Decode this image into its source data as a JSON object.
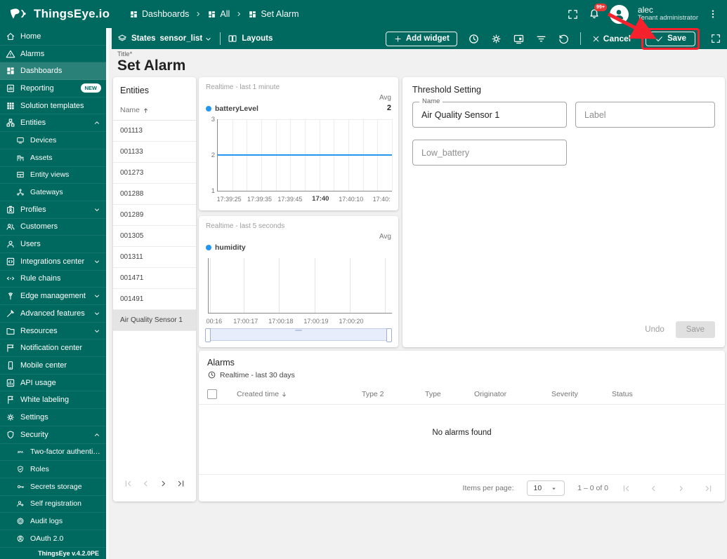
{
  "app": {
    "logo_text": "ThingsEye.io",
    "version": "ThingsEye v.4.2.0PE"
  },
  "colors": {
    "primary": "#00695f",
    "annotation_red": "#f5222d",
    "series_blue": "#2196f3"
  },
  "header": {
    "breadcrumbs": [
      {
        "label": "Dashboards",
        "icon": "dashboard"
      },
      {
        "label": "All",
        "icon": "dashboard"
      },
      {
        "label": "Set Alarm",
        "icon": "dashboard"
      }
    ],
    "notification_badge": "99+",
    "user": {
      "name": "alec",
      "role": "Tenant administrator"
    }
  },
  "toolbar": {
    "states_label": "States",
    "state_value": "sensor_list",
    "layouts_label": "Layouts",
    "add_widget_label": "Add widget",
    "cancel_label": "Cancel",
    "save_label": "Save"
  },
  "sidebar": {
    "items": [
      {
        "label": "Home",
        "icon": "home"
      },
      {
        "label": "Alarms",
        "icon": "warning"
      },
      {
        "label": "Dashboards",
        "icon": "dashboard",
        "active": true
      },
      {
        "label": "Reporting",
        "icon": "reporting",
        "badge": "NEW"
      },
      {
        "label": "Solution templates",
        "icon": "templates"
      },
      {
        "label": "Entities",
        "icon": "entities",
        "chevron": "up"
      },
      {
        "label": "Devices",
        "icon": "devices",
        "child": true
      },
      {
        "label": "Assets",
        "icon": "assets",
        "child": true
      },
      {
        "label": "Entity views",
        "icon": "entity-views",
        "child": true
      },
      {
        "label": "Gateways",
        "icon": "gateways",
        "child": true
      },
      {
        "label": "Profiles",
        "icon": "profiles",
        "chevron": "down"
      },
      {
        "label": "Customers",
        "icon": "customers"
      },
      {
        "label": "Users",
        "icon": "users"
      },
      {
        "label": "Integrations center",
        "icon": "integrations",
        "chevron": "down"
      },
      {
        "label": "Rule chains",
        "icon": "rule-chains"
      },
      {
        "label": "Edge management",
        "icon": "edge",
        "chevron": "down"
      },
      {
        "label": "Advanced features",
        "icon": "advanced",
        "chevron": "down"
      },
      {
        "label": "Resources",
        "icon": "resources",
        "chevron": "down"
      },
      {
        "label": "Notification center",
        "icon": "notification"
      },
      {
        "label": "Mobile center",
        "icon": "mobile"
      },
      {
        "label": "API usage",
        "icon": "api"
      },
      {
        "label": "White labeling",
        "icon": "white-label"
      },
      {
        "label": "Settings",
        "icon": "settings"
      },
      {
        "label": "Security",
        "icon": "security",
        "chevron": "up"
      },
      {
        "label": "Two-factor authenticati...",
        "icon": "2fa",
        "child": true
      },
      {
        "label": "Roles",
        "icon": "roles",
        "child": true
      },
      {
        "label": "Secrets storage",
        "icon": "secrets",
        "child": true
      },
      {
        "label": "Self registration",
        "icon": "self-reg",
        "child": true
      },
      {
        "label": "Audit logs",
        "icon": "audit",
        "child": true
      },
      {
        "label": "OAuth 2.0",
        "icon": "oauth",
        "child": true
      }
    ]
  },
  "page": {
    "title_label": "Title*",
    "title": "Set Alarm"
  },
  "entities_panel": {
    "title": "Entities",
    "column_label": "Name",
    "rows": [
      "001113",
      "001133",
      "001273",
      "001288",
      "001289",
      "001305",
      "001311",
      "001471",
      "001491",
      "Air Quality Sensor 1"
    ],
    "selected_index": 9
  },
  "chart_data": [
    {
      "type": "line",
      "title": "Realtime - last 1 minute",
      "agg_label": "Avg",
      "agg_value": "2",
      "series": [
        {
          "name": "batteryLevel",
          "color": "#2196f3",
          "constant_value": 2
        }
      ],
      "ylim": [
        1,
        3
      ],
      "yticks": [
        3,
        2,
        1
      ],
      "xticks": [
        "17:39:25",
        "17:39:35",
        "17:39:45",
        "17:40",
        "17:40:10",
        "17:40:"
      ],
      "bold_xtick_index": 3,
      "grid": true,
      "legend_position": "top-left"
    },
    {
      "type": "line",
      "title": "Realtime - last 5 seconds",
      "agg_label": "Avg",
      "agg_value": "",
      "series": [
        {
          "name": "humidity",
          "color": "#2196f3",
          "values": []
        }
      ],
      "xticks": [
        "00:16",
        "17:00:17",
        "17:00:18",
        "17:00:19",
        "17:00:20"
      ],
      "grid": true,
      "has_range_selector": true,
      "no_data": true
    }
  ],
  "threshold_panel": {
    "title": "Threshold Setting",
    "name_label": "Name",
    "name_value": "Air Quality Sensor 1",
    "label_placeholder": "Label",
    "alarm_type_placeholder": "Low_battery",
    "undo_label": "Undo",
    "save_label": "Save"
  },
  "alarms_panel": {
    "title": "Alarms",
    "timewindow": "Realtime - last 30 days",
    "columns": [
      "Created time",
      "Type 2",
      "Type",
      "Originator",
      "Severity",
      "Status"
    ],
    "sorted_column_index": 0,
    "empty_text": "No alarms found",
    "items_per_page_label": "Items per page:",
    "items_per_page": "10",
    "range_label": "1 – 0 of 0"
  }
}
